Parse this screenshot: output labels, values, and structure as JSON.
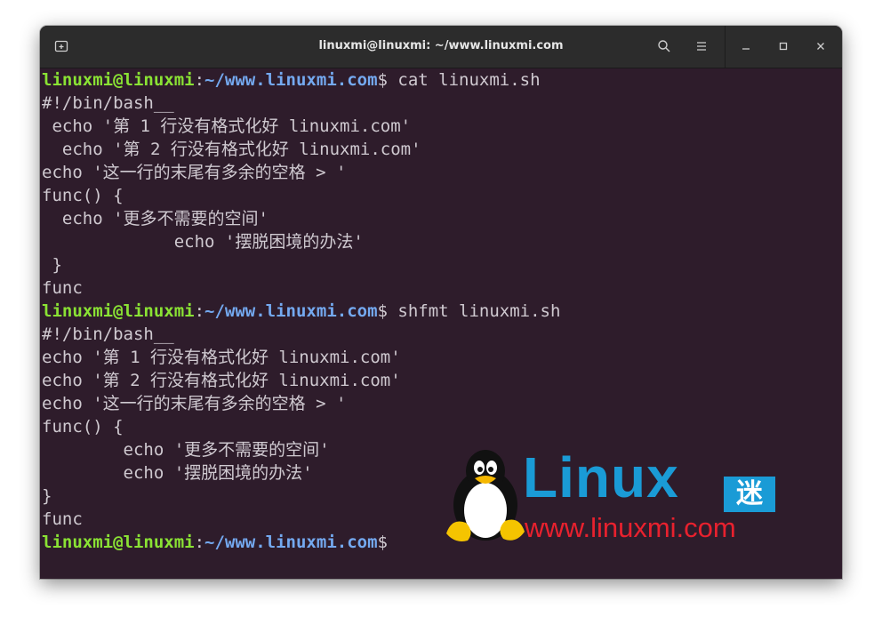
{
  "window": {
    "title": "linuxmi@linuxmi: ~/www.linuxmi.com"
  },
  "prompt": {
    "user": "linuxmi@linuxmi",
    "colon": ":",
    "path": "~/www.linuxmi.com",
    "dollar": "$"
  },
  "lines": [
    {
      "type": "prompt",
      "cmd": " cat linuxmi.sh"
    },
    {
      "type": "out",
      "text": "#!/bin/bash__"
    },
    {
      "type": "out",
      "text": " echo '第 1 行没有格式化好 linuxmi.com'"
    },
    {
      "type": "out",
      "text": "  echo '第 2 行没有格式化好 linuxmi.com'"
    },
    {
      "type": "out",
      "text": "echo '这一行的末尾有多余的空格 > '"
    },
    {
      "type": "out",
      "text": "func() {"
    },
    {
      "type": "out",
      "text": "  echo '更多不需要的空间'"
    },
    {
      "type": "out",
      "text": "             echo '摆脱困境的办法'"
    },
    {
      "type": "out",
      "text": " }"
    },
    {
      "type": "out",
      "text": "func"
    },
    {
      "type": "prompt",
      "cmd": " shfmt linuxmi.sh"
    },
    {
      "type": "out",
      "text": "#!/bin/bash__"
    },
    {
      "type": "out",
      "text": "echo '第 1 行没有格式化好 linuxmi.com'"
    },
    {
      "type": "out",
      "text": "echo '第 2 行没有格式化好 linuxmi.com'"
    },
    {
      "type": "out",
      "text": "echo '这一行的末尾有多余的空格 > '"
    },
    {
      "type": "out",
      "text": "func() {"
    },
    {
      "type": "out",
      "text": "        echo '更多不需要的空间'"
    },
    {
      "type": "out",
      "text": "        echo '摆脱困境的办法'"
    },
    {
      "type": "out",
      "text": "}"
    },
    {
      "type": "out",
      "text": "func"
    },
    {
      "type": "prompt",
      "cmd": ""
    }
  ],
  "watermark": {
    "brand": "Linux",
    "badge": "迷",
    "url": "www.linuxmi.com"
  },
  "icons": {
    "new_tab": "new-tab-icon",
    "search": "search-icon",
    "menu": "hamburger-menu-icon",
    "minimize": "minimize-icon",
    "maximize": "maximize-icon",
    "close": "close-icon"
  },
  "colors": {
    "terminal_bg": "#2e1c2b",
    "prompt_user": "#8ae234",
    "prompt_path": "#74a9f0",
    "text": "#cfc9d0",
    "watermark_blue": "#1a9bd6",
    "watermark_red": "#e8212e"
  }
}
